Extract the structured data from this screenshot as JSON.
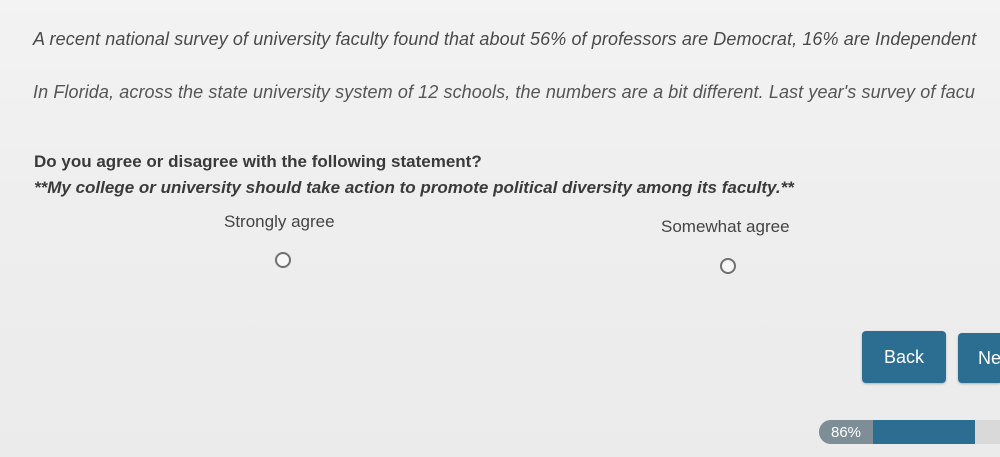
{
  "intro": {
    "line1": "A recent national survey of university faculty found that about 56% of professors are Democrat, 16% are Independent",
    "line2": "In Florida, across the state university system of 12 schools, the numbers are a bit different. Last year's survey of facu"
  },
  "question": {
    "prompt": "Do you agree or disagree with the following statement?",
    "statement": "**My college or university should take action to promote political diversity among its faculty.**"
  },
  "options": [
    {
      "label": "Strongly agree",
      "selected": false
    },
    {
      "label": "Somewhat agree",
      "selected": false
    }
  ],
  "nav": {
    "back_label": "Back",
    "next_label": "Ne"
  },
  "progress": {
    "label": "86%",
    "value": 0.86
  },
  "colors": {
    "button": "#2c6e91",
    "progress_fill": "#2c6e91"
  }
}
